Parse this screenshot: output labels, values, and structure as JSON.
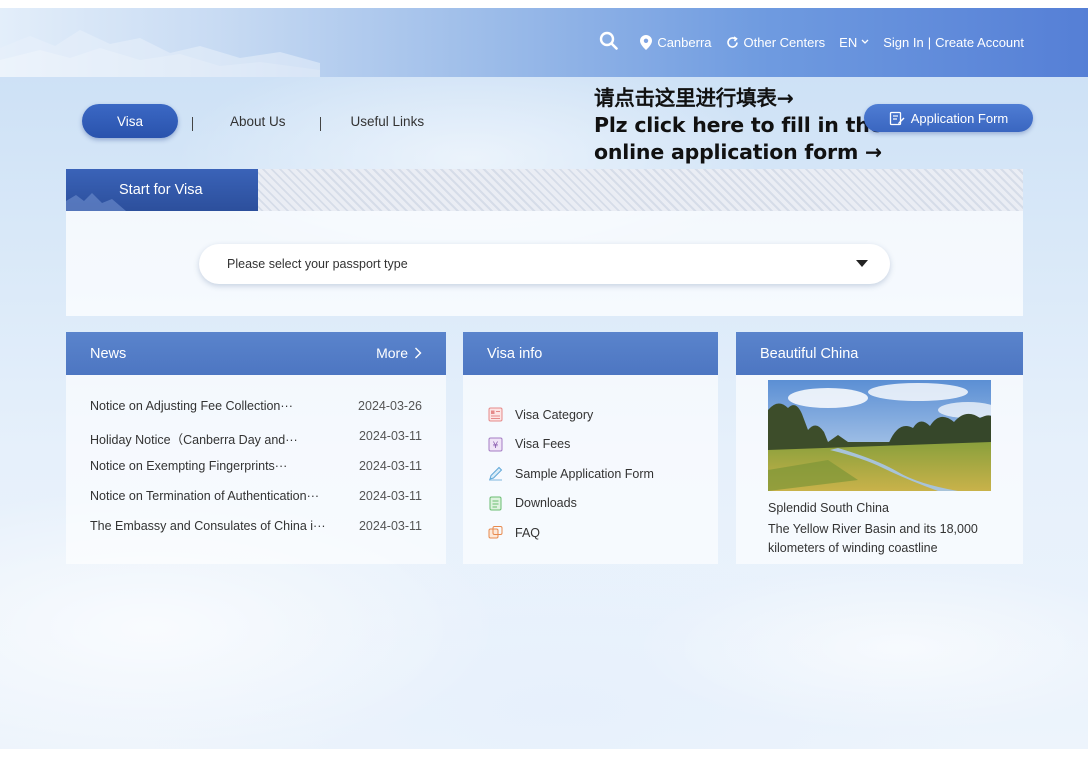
{
  "topnav": {
    "location": "Canberra",
    "other_centers": "Other Centers",
    "language": "EN",
    "sign_in": "Sign In",
    "separator": "|",
    "create_account": "Create Account"
  },
  "mainnav": {
    "visa": "Visa",
    "sep": "|",
    "about": "About Us",
    "links": "Useful Links"
  },
  "notice": {
    "line1": "请点击这里进行填表→",
    "line2": "Plz click here to fill in the",
    "line3": "online application form →"
  },
  "application_form_button": "Application Form",
  "start_visa": {
    "tab": "Start for Visa",
    "passport_placeholder": "Please select your passport type"
  },
  "news": {
    "title": "News",
    "more": "More",
    "items": [
      {
        "title": "Notice on Adjusting Fee Collection···",
        "date": "2024-03-26"
      },
      {
        "title": "Holiday Notice（Canberra Day and···",
        "date": "2024-03-11"
      },
      {
        "title": "Notice on Exempting Fingerprints···",
        "date": "2024-03-11"
      },
      {
        "title": "Notice on Termination of Authentication···",
        "date": "2024-03-11"
      },
      {
        "title": "The Embassy and Consulates of China i···",
        "date": "2024-03-11"
      }
    ]
  },
  "visa_info": {
    "title": "Visa info",
    "items": [
      {
        "label": "Visa Category",
        "icon": "category-icon"
      },
      {
        "label": "Visa Fees",
        "icon": "yen-icon"
      },
      {
        "label": "Sample Application Form",
        "icon": "pen-icon"
      },
      {
        "label": "Downloads",
        "icon": "download-icon"
      },
      {
        "label": "FAQ",
        "icon": "faq-icon"
      }
    ]
  },
  "beautiful_china": {
    "title": "Beautiful China",
    "caption_title": "Splendid South China",
    "caption_text": "The Yellow River Basin and its 18,000 kilometers of winding coastline"
  },
  "colors": {
    "accent": "#2c55ad",
    "card_header": "#5580c8"
  }
}
